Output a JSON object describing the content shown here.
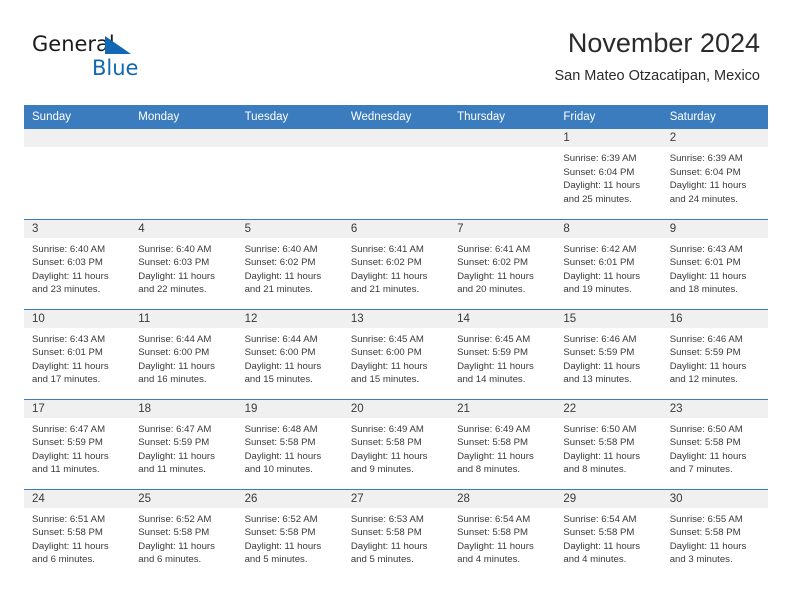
{
  "brand": {
    "name_part1": "General",
    "name_part2": "Blue",
    "accent_color": "#1268b3",
    "triangle_icon": "brand-triangle-icon"
  },
  "header": {
    "title": "November 2024",
    "subtitle": "San Mateo Otzacatipan, Mexico"
  },
  "theme": {
    "header_blue": "#3a7cbd",
    "daynum_gray": "#f0f0f0",
    "text": "#3a3a3a"
  },
  "weekdays": [
    "Sunday",
    "Monday",
    "Tuesday",
    "Wednesday",
    "Thursday",
    "Friday",
    "Saturday"
  ],
  "weeks": [
    [
      {
        "day": "",
        "blank": true
      },
      {
        "day": "",
        "blank": true
      },
      {
        "day": "",
        "blank": true
      },
      {
        "day": "",
        "blank": true
      },
      {
        "day": "",
        "blank": true
      },
      {
        "day": "1",
        "sunrise": "Sunrise: 6:39 AM",
        "sunset": "Sunset: 6:04 PM",
        "daylight": "Daylight: 11 hours and 25 minutes."
      },
      {
        "day": "2",
        "sunrise": "Sunrise: 6:39 AM",
        "sunset": "Sunset: 6:04 PM",
        "daylight": "Daylight: 11 hours and 24 minutes."
      }
    ],
    [
      {
        "day": "3",
        "sunrise": "Sunrise: 6:40 AM",
        "sunset": "Sunset: 6:03 PM",
        "daylight": "Daylight: 11 hours and 23 minutes."
      },
      {
        "day": "4",
        "sunrise": "Sunrise: 6:40 AM",
        "sunset": "Sunset: 6:03 PM",
        "daylight": "Daylight: 11 hours and 22 minutes."
      },
      {
        "day": "5",
        "sunrise": "Sunrise: 6:40 AM",
        "sunset": "Sunset: 6:02 PM",
        "daylight": "Daylight: 11 hours and 21 minutes."
      },
      {
        "day": "6",
        "sunrise": "Sunrise: 6:41 AM",
        "sunset": "Sunset: 6:02 PM",
        "daylight": "Daylight: 11 hours and 21 minutes."
      },
      {
        "day": "7",
        "sunrise": "Sunrise: 6:41 AM",
        "sunset": "Sunset: 6:02 PM",
        "daylight": "Daylight: 11 hours and 20 minutes."
      },
      {
        "day": "8",
        "sunrise": "Sunrise: 6:42 AM",
        "sunset": "Sunset: 6:01 PM",
        "daylight": "Daylight: 11 hours and 19 minutes."
      },
      {
        "day": "9",
        "sunrise": "Sunrise: 6:43 AM",
        "sunset": "Sunset: 6:01 PM",
        "daylight": "Daylight: 11 hours and 18 minutes."
      }
    ],
    [
      {
        "day": "10",
        "sunrise": "Sunrise: 6:43 AM",
        "sunset": "Sunset: 6:01 PM",
        "daylight": "Daylight: 11 hours and 17 minutes."
      },
      {
        "day": "11",
        "sunrise": "Sunrise: 6:44 AM",
        "sunset": "Sunset: 6:00 PM",
        "daylight": "Daylight: 11 hours and 16 minutes."
      },
      {
        "day": "12",
        "sunrise": "Sunrise: 6:44 AM",
        "sunset": "Sunset: 6:00 PM",
        "daylight": "Daylight: 11 hours and 15 minutes."
      },
      {
        "day": "13",
        "sunrise": "Sunrise: 6:45 AM",
        "sunset": "Sunset: 6:00 PM",
        "daylight": "Daylight: 11 hours and 15 minutes."
      },
      {
        "day": "14",
        "sunrise": "Sunrise: 6:45 AM",
        "sunset": "Sunset: 5:59 PM",
        "daylight": "Daylight: 11 hours and 14 minutes."
      },
      {
        "day": "15",
        "sunrise": "Sunrise: 6:46 AM",
        "sunset": "Sunset: 5:59 PM",
        "daylight": "Daylight: 11 hours and 13 minutes."
      },
      {
        "day": "16",
        "sunrise": "Sunrise: 6:46 AM",
        "sunset": "Sunset: 5:59 PM",
        "daylight": "Daylight: 11 hours and 12 minutes."
      }
    ],
    [
      {
        "day": "17",
        "sunrise": "Sunrise: 6:47 AM",
        "sunset": "Sunset: 5:59 PM",
        "daylight": "Daylight: 11 hours and 11 minutes."
      },
      {
        "day": "18",
        "sunrise": "Sunrise: 6:47 AM",
        "sunset": "Sunset: 5:59 PM",
        "daylight": "Daylight: 11 hours and 11 minutes."
      },
      {
        "day": "19",
        "sunrise": "Sunrise: 6:48 AM",
        "sunset": "Sunset: 5:58 PM",
        "daylight": "Daylight: 11 hours and 10 minutes."
      },
      {
        "day": "20",
        "sunrise": "Sunrise: 6:49 AM",
        "sunset": "Sunset: 5:58 PM",
        "daylight": "Daylight: 11 hours and 9 minutes."
      },
      {
        "day": "21",
        "sunrise": "Sunrise: 6:49 AM",
        "sunset": "Sunset: 5:58 PM",
        "daylight": "Daylight: 11 hours and 8 minutes."
      },
      {
        "day": "22",
        "sunrise": "Sunrise: 6:50 AM",
        "sunset": "Sunset: 5:58 PM",
        "daylight": "Daylight: 11 hours and 8 minutes."
      },
      {
        "day": "23",
        "sunrise": "Sunrise: 6:50 AM",
        "sunset": "Sunset: 5:58 PM",
        "daylight": "Daylight: 11 hours and 7 minutes."
      }
    ],
    [
      {
        "day": "24",
        "sunrise": "Sunrise: 6:51 AM",
        "sunset": "Sunset: 5:58 PM",
        "daylight": "Daylight: 11 hours and 6 minutes."
      },
      {
        "day": "25",
        "sunrise": "Sunrise: 6:52 AM",
        "sunset": "Sunset: 5:58 PM",
        "daylight": "Daylight: 11 hours and 6 minutes."
      },
      {
        "day": "26",
        "sunrise": "Sunrise: 6:52 AM",
        "sunset": "Sunset: 5:58 PM",
        "daylight": "Daylight: 11 hours and 5 minutes."
      },
      {
        "day": "27",
        "sunrise": "Sunrise: 6:53 AM",
        "sunset": "Sunset: 5:58 PM",
        "daylight": "Daylight: 11 hours and 5 minutes."
      },
      {
        "day": "28",
        "sunrise": "Sunrise: 6:54 AM",
        "sunset": "Sunset: 5:58 PM",
        "daylight": "Daylight: 11 hours and 4 minutes."
      },
      {
        "day": "29",
        "sunrise": "Sunrise: 6:54 AM",
        "sunset": "Sunset: 5:58 PM",
        "daylight": "Daylight: 11 hours and 4 minutes."
      },
      {
        "day": "30",
        "sunrise": "Sunrise: 6:55 AM",
        "sunset": "Sunset: 5:58 PM",
        "daylight": "Daylight: 11 hours and 3 minutes."
      }
    ]
  ]
}
